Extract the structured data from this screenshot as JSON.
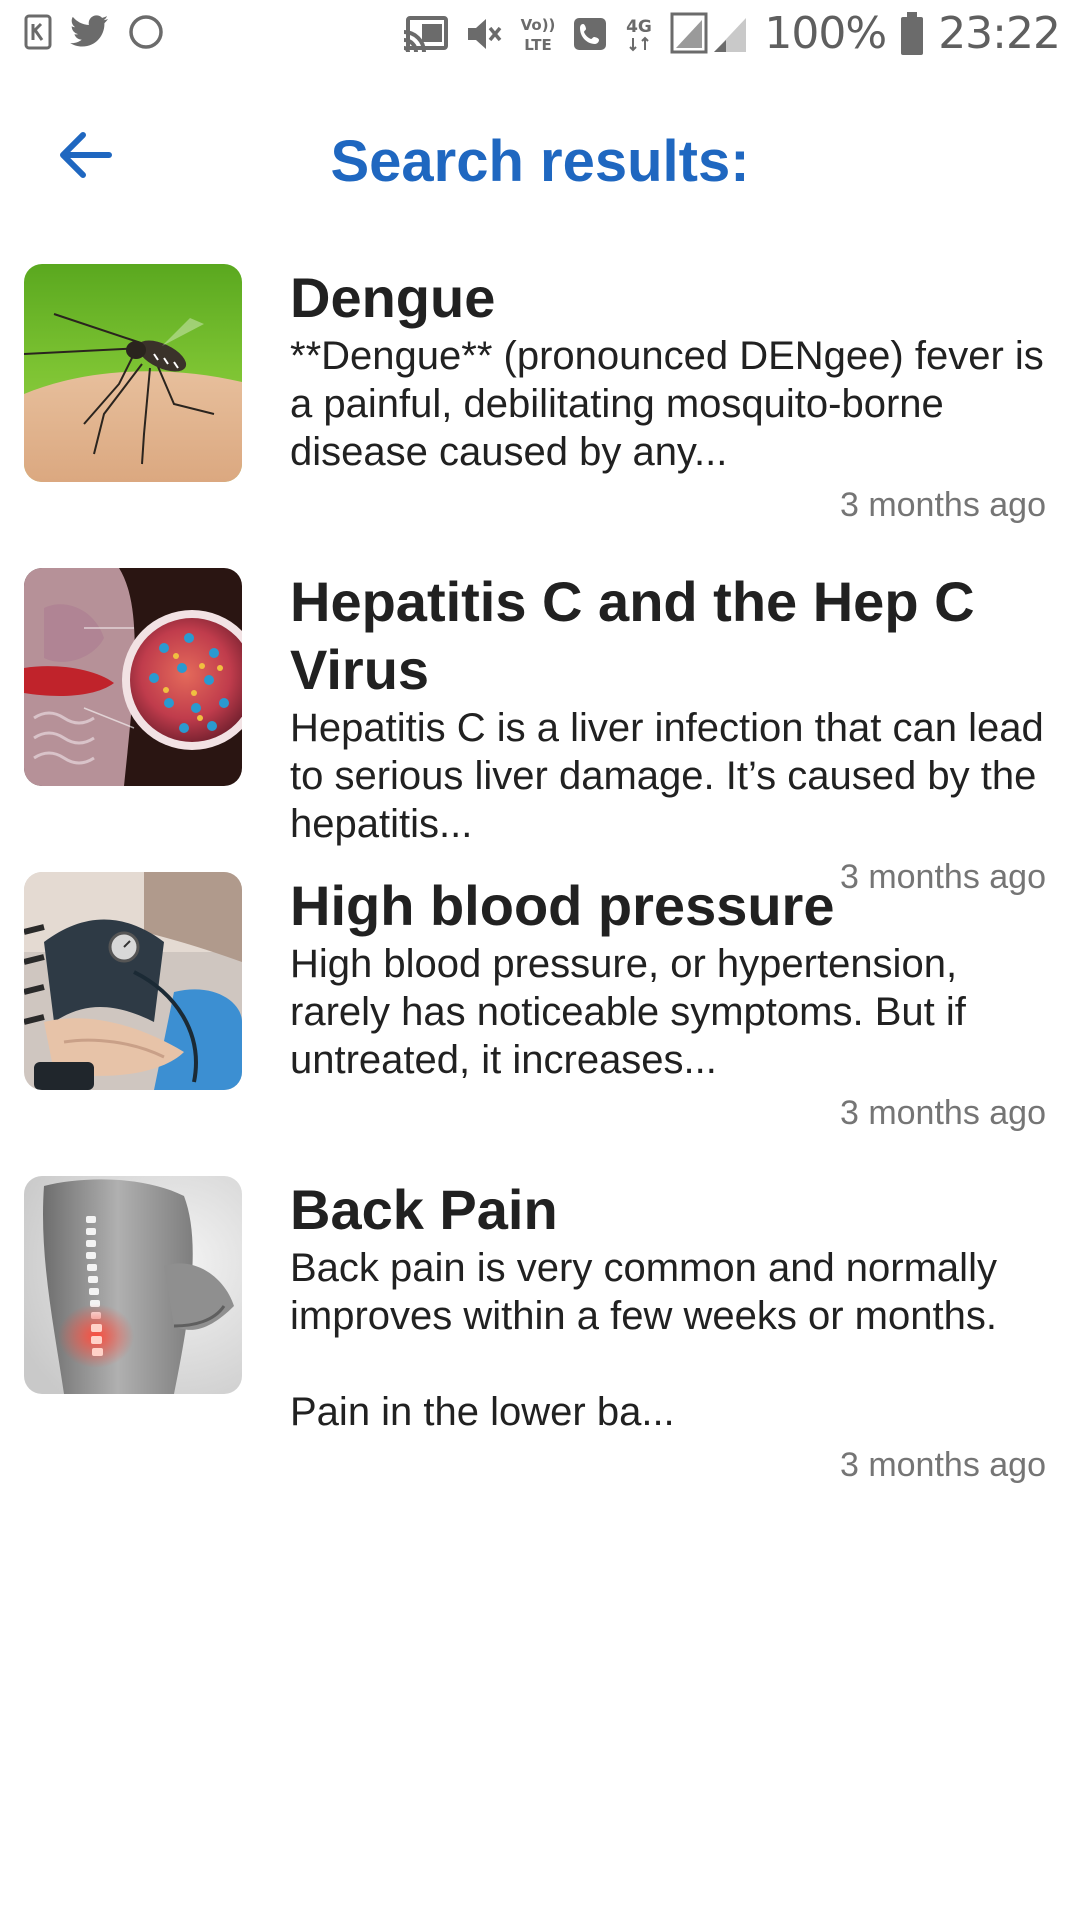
{
  "status_bar": {
    "battery": "100%",
    "time": "23:22",
    "network_label": "4G",
    "volte_label": "Vo)) LTE",
    "icons": [
      "kinemaster-icon",
      "twitter-icon",
      "circle-icon",
      "cast-icon",
      "mute-icon",
      "volte-icon",
      "call-icon",
      "signal-icon",
      "battery-icon"
    ]
  },
  "header": {
    "title": "Search results:",
    "back_icon": "arrow-left-icon",
    "accent_color": "#1f67c0"
  },
  "results": [
    {
      "title": "Dengue",
      "snippet": "**Dengue** (pronounced DENgee) fever is a painful, debilitating mosquito-borne disease caused by any...",
      "time": "3 months ago",
      "image": "mosquito-image"
    },
    {
      "title": "Hepatitis C and the Hep C Virus",
      "snippet": "Hepatitis C is a liver infection that can lead to serious liver damage. It’s caused by the hepatitis...",
      "time": "3 months ago",
      "image": "liver-virus-image"
    },
    {
      "title": "High blood pressure",
      "snippet": "High blood pressure, or hypertension, rarely has noticeable symptoms. But if untreated, it increases...",
      "time": "3 months ago",
      "image": "blood-pressure-cuff-image"
    },
    {
      "title": "Back Pain",
      "snippet": "Back pain is very common and normally improves within a few weeks or months.\n\nPain in the lower ba...",
      "time": "3 months ago",
      "image": "back-pain-image"
    }
  ]
}
